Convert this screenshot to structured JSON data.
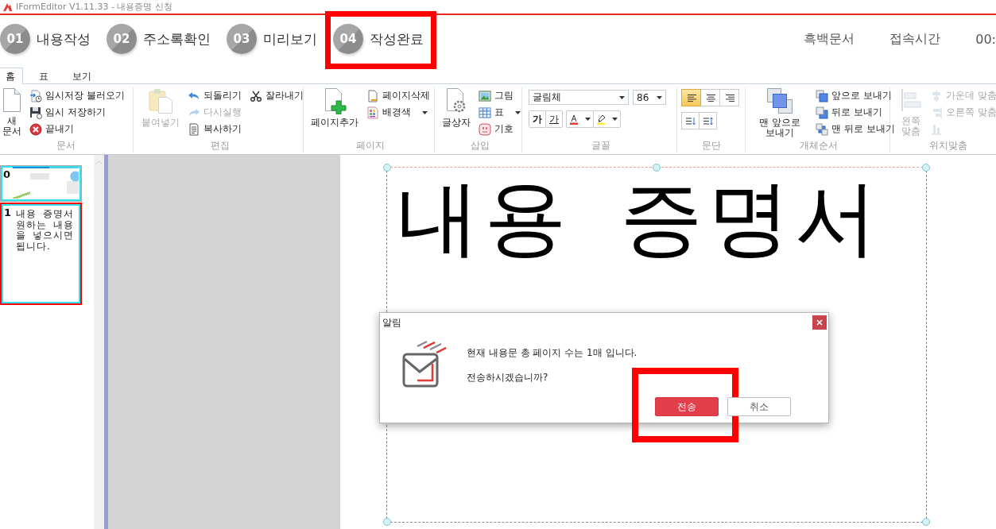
{
  "window": {
    "title": "IFormEditor V1.11.33 - 내용증명 신청"
  },
  "steps": [
    {
      "number": "01",
      "label": "내용작성",
      "annotated": false
    },
    {
      "number": "02",
      "label": "주소록확인",
      "annotated": false
    },
    {
      "number": "03",
      "label": "미리보기",
      "annotated": false
    },
    {
      "number": "04",
      "label": "작성완료",
      "annotated": true
    }
  ],
  "header": {
    "mono_document": "흑백문서",
    "session_label": "접속시간",
    "session_time": "00:"
  },
  "ribbon": {
    "tabs": [
      {
        "label": "홈",
        "selected": true
      },
      {
        "label": "표",
        "selected": false
      },
      {
        "label": "보기",
        "selected": false
      }
    ],
    "groups": [
      {
        "kind": "buttons",
        "label": "문서",
        "large": [
          {
            "label": "새 문서",
            "disabled": false
          }
        ],
        "columns": [
          [
            {
              "label": "임시저장 불러오기",
              "disabled": false,
              "dropdown": false
            },
            {
              "label": "임시 저장하기",
              "disabled": false,
              "dropdown": false
            },
            {
              "label": "끝내기",
              "disabled": false,
              "dropdown": false
            }
          ]
        ]
      },
      {
        "kind": "buttons",
        "label": "편집",
        "large": [
          {
            "label": "붙여넣기",
            "disabled": true
          }
        ],
        "columns": [
          [
            {
              "label": "되돌리기",
              "disabled": false,
              "dropdown": false
            },
            {
              "label": "다시실행",
              "disabled": true,
              "dropdown": false
            },
            {
              "label": "복사하기",
              "disabled": false,
              "dropdown": false
            }
          ],
          [
            {
              "label": "잘라내기",
              "disabled": false,
              "dropdown": false
            }
          ]
        ]
      },
      {
        "kind": "buttons",
        "label": "페이지",
        "large": [
          {
            "label": "페이지추가",
            "disabled": false
          }
        ],
        "columns": [
          [
            {
              "label": "페이지삭제",
              "disabled": false,
              "dropdown": false
            },
            {
              "label": "배경색",
              "disabled": false,
              "dropdown": true
            }
          ]
        ]
      },
      {
        "kind": "buttons",
        "label": "삽입",
        "large": [
          {
            "label": "글상자",
            "disabled": false
          }
        ],
        "columns": [
          [
            {
              "label": "그림",
              "disabled": false,
              "dropdown": false
            },
            {
              "label": "표",
              "disabled": false,
              "dropdown": true
            },
            {
              "label": "기호",
              "disabled": false,
              "dropdown": false
            }
          ]
        ]
      },
      {
        "kind": "font",
        "label": "글꼴",
        "font": "굴림체",
        "size": "86",
        "styles": [
          {
            "kind": "bold",
            "label": "가"
          },
          {
            "kind": "underline",
            "label": "가"
          }
        ]
      },
      {
        "kind": "paragraph",
        "label": "문단",
        "alignments": [
          {
            "selected": true
          },
          {
            "selected": false
          },
          {
            "selected": false
          }
        ]
      },
      {
        "kind": "buttons",
        "label": "개체순서",
        "large": [
          {
            "label": "맨 앞으로 보내기",
            "disabled": false
          }
        ],
        "columns": [
          [
            {
              "label": "앞으로 보내기",
              "disabled": false,
              "dropdown": false
            },
            {
              "label": "뒤로 보내기",
              "disabled": false,
              "dropdown": false
            },
            {
              "label": "맨 뒤로 보내기",
              "disabled": false,
              "dropdown": false
            }
          ]
        ]
      },
      {
        "kind": "buttons",
        "label": "위치맞춤",
        "large": [
          {
            "label": "왼쪽 맞춤",
            "disabled": true
          }
        ],
        "columns": [
          [
            {
              "label": "가운데 맞춤",
              "disabled": true,
              "dropdown": false
            },
            {
              "label": "오른쪽 맞춤",
              "disabled": true,
              "dropdown": false
            },
            {
              "disabled": true,
              "dropdown": false
            }
          ]
        ]
      }
    ]
  },
  "pages": [
    {
      "number": "0",
      "selected": false
    },
    {
      "number": "1",
      "selected": true,
      "lines": [
        "내용 증명서",
        "원하는 내용",
        "을 넣으시면",
        "됩니다."
      ]
    }
  ],
  "document": {
    "lines": [
      "내용 증명서"
    ]
  },
  "dialog": {
    "title": "알림",
    "message": [
      "현재 내용문 총 페이지 수는 1매 입니다.",
      "전송하시겠습니까?"
    ],
    "buttons": [
      {
        "label": "전송",
        "kind": "primary",
        "annotated": true
      },
      {
        "label": "취소",
        "kind": "secondary",
        "annotated": false
      }
    ]
  }
}
